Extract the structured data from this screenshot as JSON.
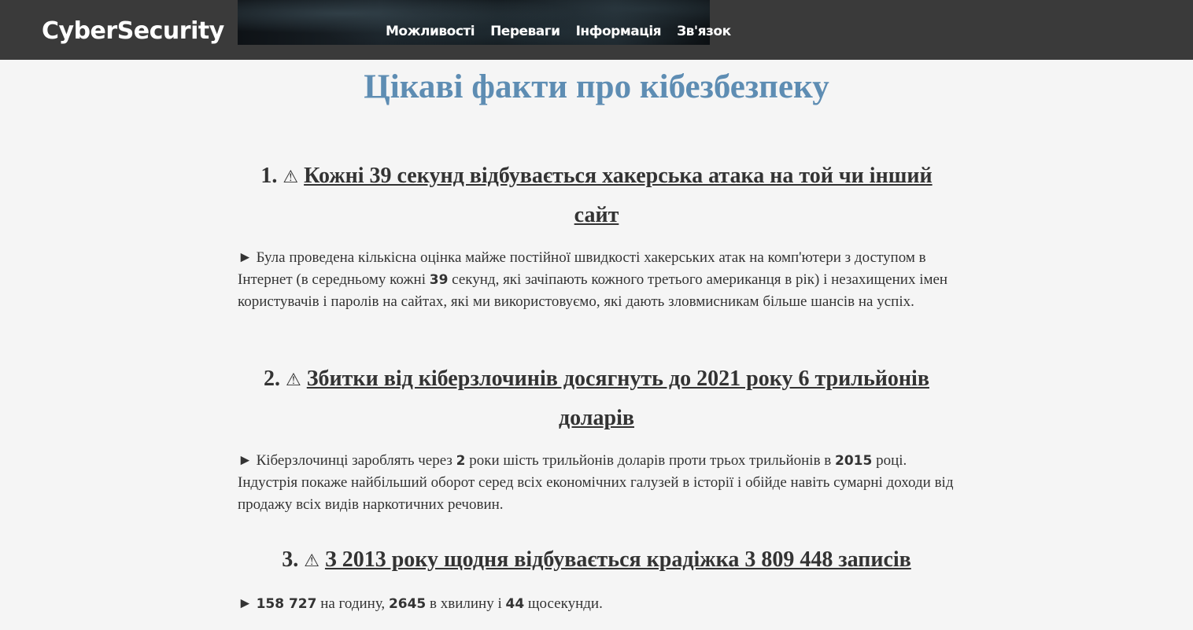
{
  "header": {
    "logo": "CyberSecurity",
    "nav": [
      "Можливості",
      "Переваги",
      "Інформація",
      "Зв'язок"
    ]
  },
  "page_title": "Цікаві факти про кібезбезпеку",
  "warning_glyph": "⚠",
  "bullet_glyph": "►",
  "facts": [
    {
      "number": "1.",
      "title": "Кожні 39 секунд відбувається хакерська атака на той чи інший сайт",
      "text_parts": [
        "Була проведена кількісна оцінка майже постійної швидкості хакерських атак на комп'ютери з доступом в Інтернет (в середньому кожні ",
        "39",
        " секунд, які зачіпають кожного третього американця в рік) і незахищених імен користувачів і паролів на сайтах, які ми використовуємо, які дають зловмисникам більше шансів на успіх."
      ]
    },
    {
      "number": "2.",
      "title": "Збитки від кіберзлочинів досягнуть до 2021 року 6 трильйонів доларів",
      "text_parts": [
        "Кіберзлочинці зароблять через ",
        "2",
        " роки шість трильйонів доларів проти трьох трильйонів в ",
        "2015",
        " році. Індустрія покаже найбільший оборот серед всіх економічних галузей в історії і обійде навіть сумарні доходи від продажу всіх видів наркотичних речовин."
      ]
    },
    {
      "number": "3.",
      "title": "З 2013 року щодня відбувається крадіжка 3 809 448 записів",
      "text_parts": [
        "158 727",
        " на годину, ",
        "2645",
        " в хвилину і ",
        "44",
        " щосекунди."
      ]
    }
  ],
  "colors": {
    "header_bg": "#3a3a3a",
    "page_bg": "#f5f5f5",
    "title_color": "#5e8db3",
    "text_color": "#333333"
  }
}
